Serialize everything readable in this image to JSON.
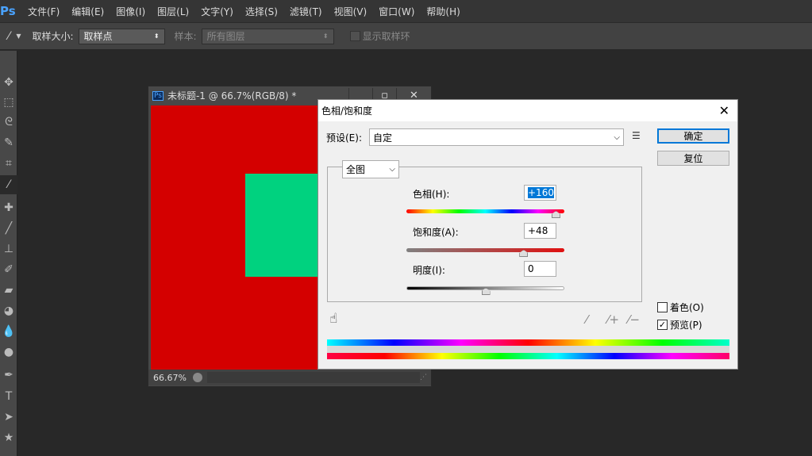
{
  "app": {
    "logo": "Ps"
  },
  "menu": [
    "文件(F)",
    "编辑(E)",
    "图像(I)",
    "图层(L)",
    "文字(Y)",
    "选择(S)",
    "滤镜(T)",
    "视图(V)",
    "窗口(W)",
    "帮助(H)"
  ],
  "options": {
    "sample_size_label": "取样大小:",
    "sample_size_value": "取样点",
    "sample_label": "样本:",
    "sample_value": "所有图层",
    "show_ring_label": "显示取样环"
  },
  "document": {
    "title": "未标题-1 @ 66.7%(RGB/8) *",
    "zoom": "66.67%",
    "ps_badge": "Ps",
    "colors": {
      "background": "#d40000",
      "shape": "#00d27f"
    }
  },
  "dialog": {
    "title": "色相/饱和度",
    "preset_label": "预设(E):",
    "preset_value": "自定",
    "ok": "确定",
    "reset": "复位",
    "channel": "全图",
    "hue_label": "色相(H):",
    "hue_value": "+160",
    "saturation_label": "饱和度(A):",
    "saturation_value": "+48",
    "lightness_label": "明度(I):",
    "lightness_value": "0",
    "colorize_label": "着色(O)",
    "colorize_checked": false,
    "preview_label": "预览(P)",
    "preview_checked": true,
    "hue": 160,
    "saturation": 48,
    "lightness": 0
  }
}
